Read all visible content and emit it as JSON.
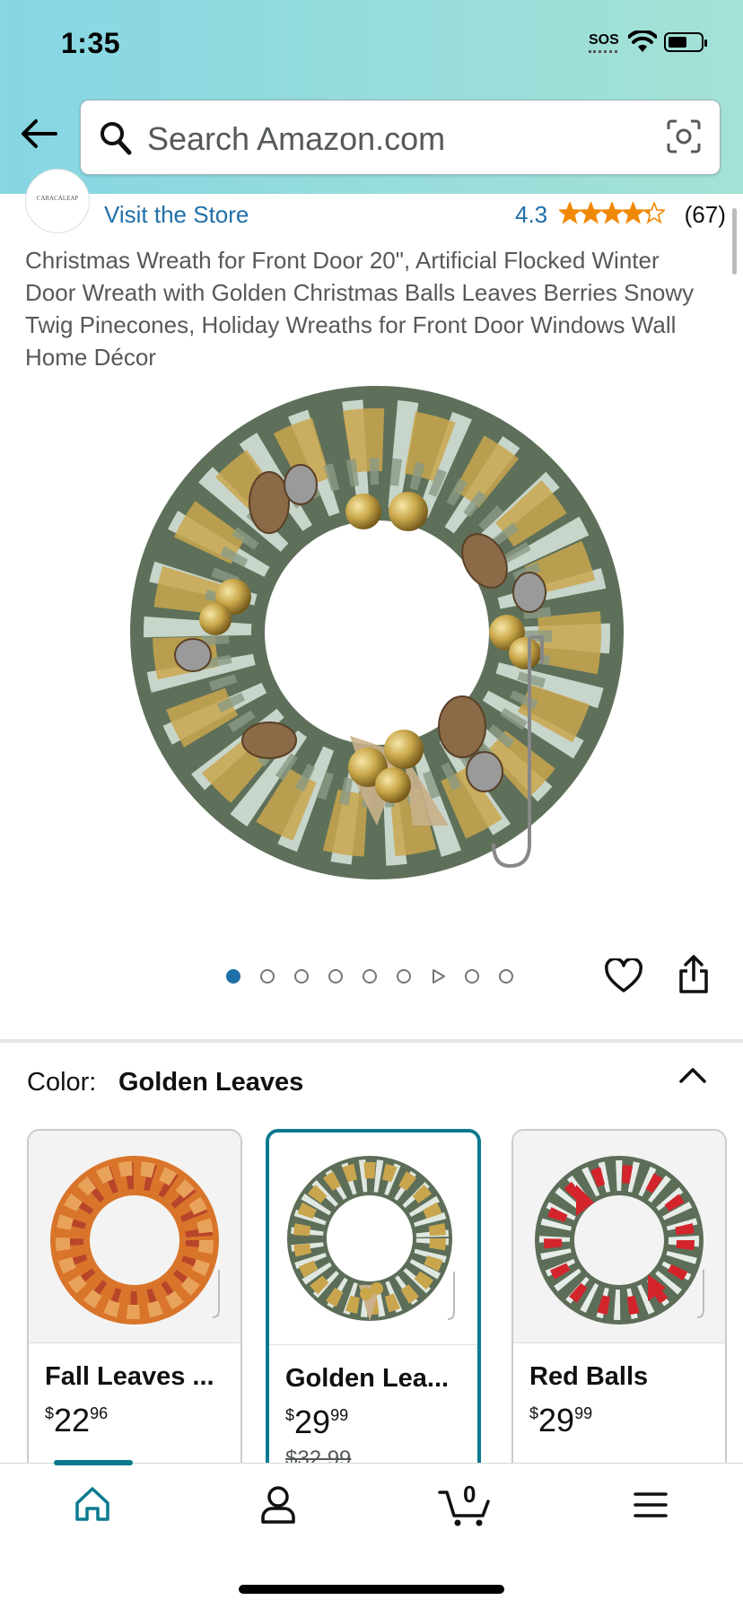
{
  "status_bar": {
    "time": "1:35",
    "sos": "SOS"
  },
  "search": {
    "placeholder": "Search Amazon.com"
  },
  "brand": {
    "logo_text": "CARACALEAP",
    "visit_store": "Visit the Store"
  },
  "rating": {
    "value": "4.3",
    "stars": 4.3,
    "count": "(67)"
  },
  "product": {
    "title": "Christmas Wreath for Front Door 20\", Artificial Flocked Winter Door Wreath with Golden Christmas Balls Leaves Berries Snowy Twig Pinecones, Holiday Wreaths for Front Door Windows Wall Home Décor",
    "image_count": 9,
    "active_image": 1
  },
  "variation": {
    "label": "Color:",
    "selected": "Golden Leaves",
    "options": [
      {
        "name": "Fall Leaves ...",
        "price_whole": "22",
        "price_fraction": "96",
        "currency": "$",
        "list_price": ""
      },
      {
        "name": "Golden Lea...",
        "price_whole": "29",
        "price_fraction": "99",
        "currency": "$",
        "list_price": "$32.99"
      },
      {
        "name": "Red Balls",
        "price_whole": "29",
        "price_fraction": "99",
        "currency": "$",
        "list_price": ""
      }
    ]
  },
  "tabbar": {
    "cart_count": "0",
    "active_tab": "home"
  },
  "colors": {
    "accent": "#0b7a8f",
    "link": "#1f6fa8",
    "star": "#f08804"
  }
}
